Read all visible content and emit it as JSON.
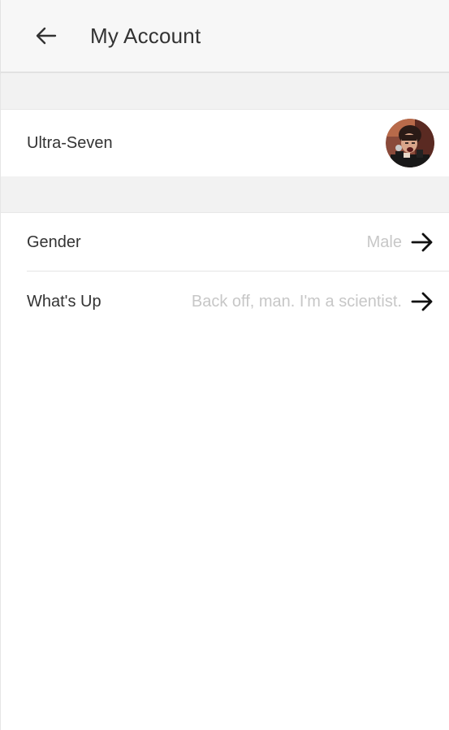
{
  "header": {
    "back_icon": "back-arrow-icon",
    "title": "My Account"
  },
  "profile": {
    "name": "Ultra-Seven",
    "avatar": "user-avatar-photo"
  },
  "settings": [
    {
      "label": "Gender",
      "value": "Male",
      "icon": "arrow-right-icon"
    },
    {
      "label": "What's Up",
      "value": "Back off, man. I'm a scientist.",
      "icon": "arrow-right-icon"
    }
  ],
  "colors": {
    "header_bg": "#f7f7f7",
    "section_gap": "#f2f2f2",
    "text_primary": "#333333",
    "text_secondary": "#c7c7c7"
  }
}
